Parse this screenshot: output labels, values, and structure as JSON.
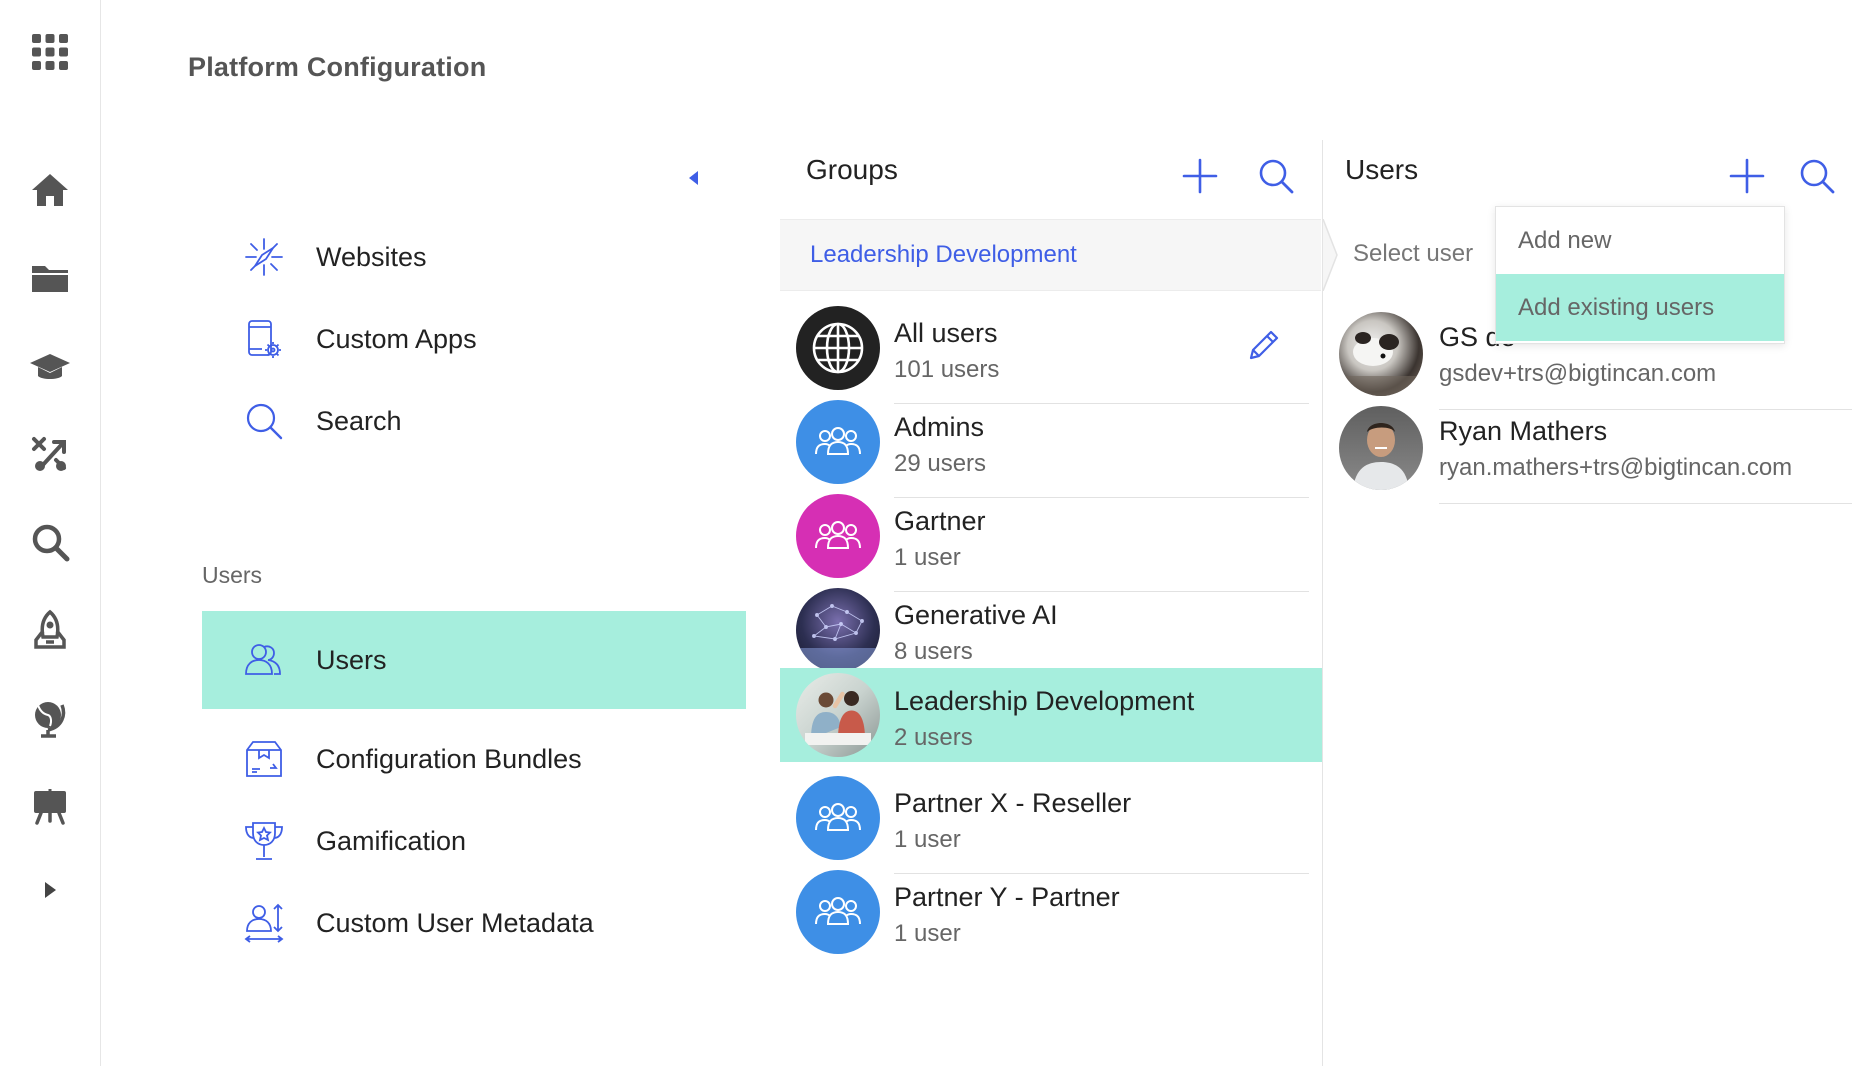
{
  "page": {
    "title": "Platform Configuration"
  },
  "rail": {
    "items": [
      {
        "icon": "apps-grid-icon"
      },
      {
        "icon": "home-icon"
      },
      {
        "icon": "folder-icon"
      },
      {
        "icon": "graduation-cap-icon"
      },
      {
        "icon": "shuffle-icon"
      },
      {
        "icon": "search-icon"
      },
      {
        "icon": "rocket-icon"
      },
      {
        "icon": "globe-icon"
      },
      {
        "icon": "presentation-icon"
      },
      {
        "icon": "expand-icon"
      }
    ]
  },
  "nav": {
    "items_top": [
      {
        "label": "Websites",
        "icon": "compass-icon"
      },
      {
        "label": "Custom Apps",
        "icon": "tablet-gear-icon"
      },
      {
        "label": "Search",
        "icon": "search-icon"
      }
    ],
    "section_label": "Users",
    "items_users": [
      {
        "label": "Users",
        "icon": "users-icon",
        "active": true
      },
      {
        "label": "Configuration Bundles",
        "icon": "box-icon"
      },
      {
        "label": "Gamification",
        "icon": "trophy-icon"
      },
      {
        "label": "Custom User Metadata",
        "icon": "user-metadata-icon"
      }
    ]
  },
  "groups": {
    "title": "Groups",
    "breadcrumb": "Leadership Development",
    "rows": [
      {
        "name": "All users",
        "count": "101 users",
        "avatar": "globe",
        "color": "#222222"
      },
      {
        "name": "Admins",
        "count": "29 users",
        "avatar": "group",
        "color": "#3e8fe6"
      },
      {
        "name": "Gartner",
        "count": "1 user",
        "avatar": "group",
        "color": "#d62fb4"
      },
      {
        "name": "Generative AI",
        "count": "8 users",
        "avatar": "photo-network",
        "color": "#2a2f4a"
      },
      {
        "name": "Leadership Development",
        "count": "2 users",
        "avatar": "photo-people",
        "color": "#9aa6a2",
        "active": true
      },
      {
        "name": "Partner X - Reseller",
        "count": "1 user",
        "avatar": "group",
        "color": "#3e8fe6"
      },
      {
        "name": "Partner Y - Partner",
        "count": "1 user",
        "avatar": "group",
        "color": "#3e8fe6"
      }
    ]
  },
  "users": {
    "title": "Users",
    "select_label": "Select user",
    "rows": [
      {
        "name": "GS de",
        "email": "gsdev+trs@bigtincan.com",
        "avatar": "photo-dog"
      },
      {
        "name": "Ryan Mathers",
        "email": "ryan.mathers+trs@bigtincan.com",
        "avatar": "photo-man"
      }
    ]
  },
  "dropdown": {
    "items": [
      {
        "label": "Add new"
      },
      {
        "label": "Add existing users",
        "active": true
      }
    ]
  },
  "colors": {
    "accent": "#3f5ee6",
    "highlight": "#a6eedd",
    "rail_icon": "#555555"
  }
}
